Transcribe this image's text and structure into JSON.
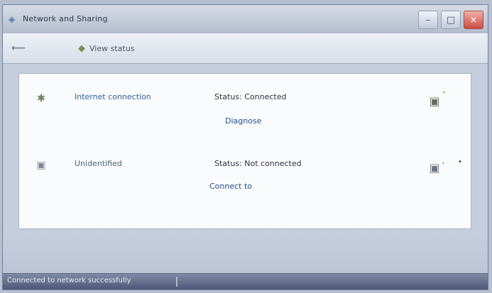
{
  "window": {
    "title": "Network and Sharing",
    "minimize_label": "–",
    "maximize_label": "□",
    "close_label": "×"
  },
  "toolbar": {
    "back_label": "⟵",
    "item_label": "View status",
    "item_icon": "◆",
    "right_label": ""
  },
  "connections": [
    {
      "name": "Internet connection",
      "status": "Status: Connected",
      "link": "Diagnose",
      "left_icon": "✱",
      "right_icon": "▣",
      "right_mark": "✦",
      "side_label": ""
    },
    {
      "name": "Unidentified",
      "status": "Status: Not connected",
      "link": "Connect to",
      "left_icon": "▣",
      "right_icon": "▣",
      "right_mark": "•",
      "side_label": "•"
    }
  ],
  "statusbar": {
    "text": "Connected to network successfully"
  }
}
